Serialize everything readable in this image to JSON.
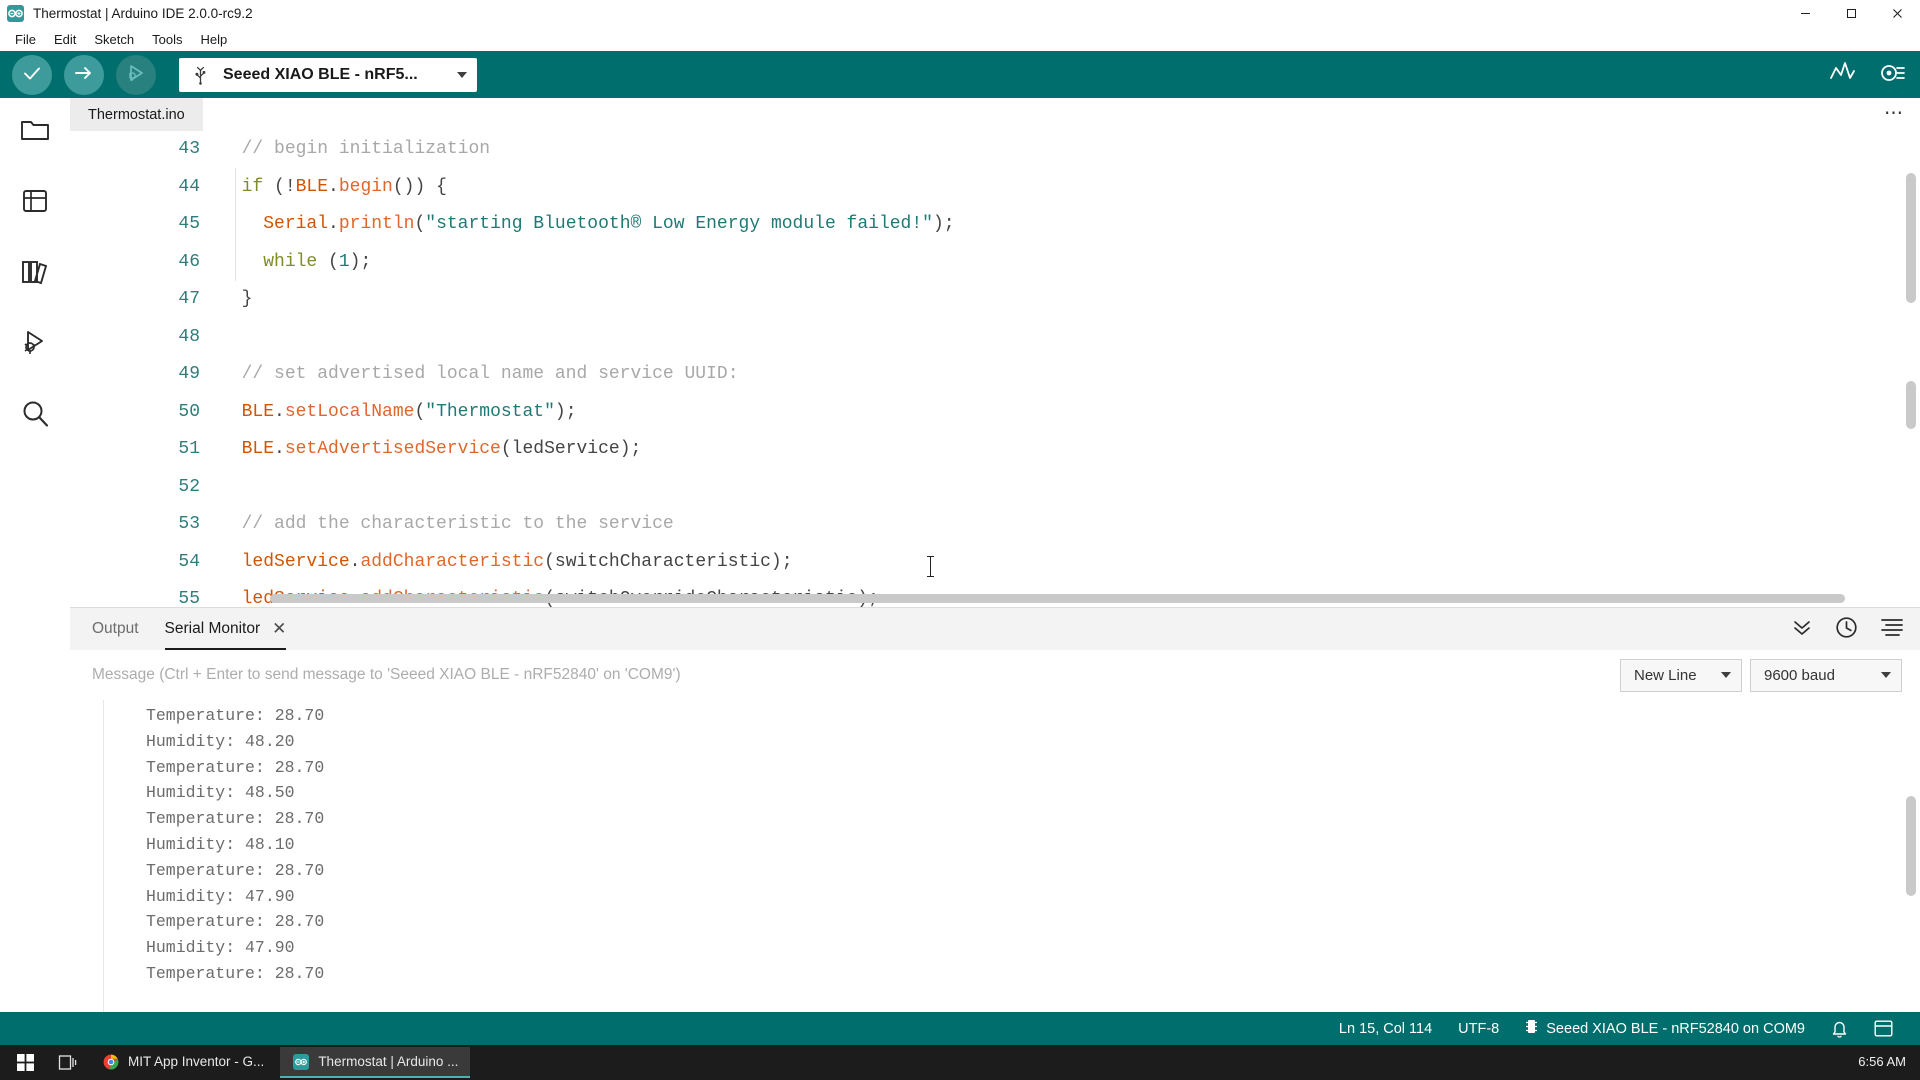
{
  "window": {
    "title": "Thermostat | Arduino IDE 2.0.0-rc9.2",
    "app_icon": "arduino-infinity-icon",
    "minimize_label": "─",
    "maximize_label": "☐",
    "close_label": "✕"
  },
  "menubar": {
    "items": [
      {
        "label": "File"
      },
      {
        "label": "Edit"
      },
      {
        "label": "Sketch"
      },
      {
        "label": "Tools"
      },
      {
        "label": "Help"
      }
    ]
  },
  "toolbar": {
    "verify_icon": "checkmark-icon",
    "upload_icon": "arrow-right-icon",
    "debug_icon": "debug-bug-icon",
    "board_selector": {
      "usb_icon": "usb-icon",
      "value": "Seeed XIAO BLE - nRF5...",
      "caret_icon": "chevron-down-icon"
    },
    "serial_plotter_icon": "serial-plotter-icon",
    "serial_monitor_icon": "serial-monitor-icon",
    "accent_color": "#006e6d"
  },
  "activity_bar": {
    "items": [
      {
        "name": "sketchbook",
        "icon": "folder-icon"
      },
      {
        "name": "boards-manager",
        "icon": "boards-manager-icon"
      },
      {
        "name": "library-manager",
        "icon": "library-books-icon"
      },
      {
        "name": "debug",
        "icon": "debug-icon"
      },
      {
        "name": "search",
        "icon": "search-icon"
      }
    ]
  },
  "editor": {
    "tabs": [
      {
        "label": "Thermostat.ino",
        "active": true
      }
    ],
    "more_label": "⋯",
    "lines": [
      {
        "num": "43",
        "tokens": [
          {
            "t": "  ",
            "c": "g-pln"
          },
          {
            "t": "// begin initialization",
            "c": "g-com"
          }
        ]
      },
      {
        "num": "44",
        "tokens": [
          {
            "t": "  ",
            "c": "g-pln"
          },
          {
            "t": "if",
            "c": "g-key"
          },
          {
            "t": " (!",
            "c": "g-pln"
          },
          {
            "t": "BLE",
            "c": "g-obj"
          },
          {
            "t": ".",
            "c": "g-pln"
          },
          {
            "t": "begin",
            "c": "g-fn"
          },
          {
            "t": "()) {",
            "c": "g-pln"
          }
        ]
      },
      {
        "num": "45",
        "tokens": [
          {
            "t": "    ",
            "c": "g-pln"
          },
          {
            "t": "Serial",
            "c": "g-obj"
          },
          {
            "t": ".",
            "c": "g-pln"
          },
          {
            "t": "println",
            "c": "g-fn"
          },
          {
            "t": "(",
            "c": "g-pln"
          },
          {
            "t": "\"starting Bluetooth® Low Energy module failed!\"",
            "c": "g-str"
          },
          {
            "t": ");",
            "c": "g-pln"
          }
        ]
      },
      {
        "num": "46",
        "tokens": [
          {
            "t": "    ",
            "c": "g-pln"
          },
          {
            "t": "while",
            "c": "g-key"
          },
          {
            "t": " (",
            "c": "g-pln"
          },
          {
            "t": "1",
            "c": "g-num"
          },
          {
            "t": ");",
            "c": "g-pln"
          }
        ]
      },
      {
        "num": "47",
        "tokens": [
          {
            "t": "  }",
            "c": "g-pln"
          }
        ]
      },
      {
        "num": "48",
        "tokens": [
          {
            "t": "",
            "c": "g-pln"
          }
        ]
      },
      {
        "num": "49",
        "tokens": [
          {
            "t": "  ",
            "c": "g-pln"
          },
          {
            "t": "// set advertised local name and service UUID:",
            "c": "g-com"
          }
        ]
      },
      {
        "num": "50",
        "tokens": [
          {
            "t": "  ",
            "c": "g-pln"
          },
          {
            "t": "BLE",
            "c": "g-obj"
          },
          {
            "t": ".",
            "c": "g-pln"
          },
          {
            "t": "setLocalName",
            "c": "g-fn"
          },
          {
            "t": "(",
            "c": "g-pln"
          },
          {
            "t": "\"Thermostat\"",
            "c": "g-str"
          },
          {
            "t": ");",
            "c": "g-pln"
          }
        ]
      },
      {
        "num": "51",
        "tokens": [
          {
            "t": "  ",
            "c": "g-pln"
          },
          {
            "t": "BLE",
            "c": "g-obj"
          },
          {
            "t": ".",
            "c": "g-pln"
          },
          {
            "t": "setAdvertisedService",
            "c": "g-fn"
          },
          {
            "t": "(ledService);",
            "c": "g-pln"
          }
        ]
      },
      {
        "num": "52",
        "tokens": [
          {
            "t": "",
            "c": "g-pln"
          }
        ]
      },
      {
        "num": "53",
        "tokens": [
          {
            "t": "  ",
            "c": "g-pln"
          },
          {
            "t": "// add the characteristic to the service",
            "c": "g-com"
          }
        ]
      },
      {
        "num": "54",
        "tokens": [
          {
            "t": "  ",
            "c": "g-pln"
          },
          {
            "t": "ledService",
            "c": "g-obj"
          },
          {
            "t": ".",
            "c": "g-pln"
          },
          {
            "t": "addCharacteristic",
            "c": "g-fn"
          },
          {
            "t": "(switchCharacteristic);",
            "c": "g-pln"
          }
        ]
      },
      {
        "num": "55",
        "tokens": [
          {
            "t": "  ",
            "c": "g-pln"
          },
          {
            "t": "ledService",
            "c": "g-obj"
          },
          {
            "t": ".",
            "c": "g-pln"
          },
          {
            "t": "addCharacteristic",
            "c": "g-fn"
          },
          {
            "t": "(switchOverrideCharacteristic);",
            "c": "g-pln"
          }
        ]
      }
    ]
  },
  "panel": {
    "tabs": [
      {
        "label": "Output",
        "active": false
      },
      {
        "label": "Serial Monitor",
        "active": true,
        "close_icon": "close-icon",
        "close_label": "✕"
      }
    ],
    "actions": [
      {
        "name": "collapse-panel",
        "icon": "chevron-double-down-icon"
      },
      {
        "name": "toggle-timestamp",
        "icon": "clock-icon"
      },
      {
        "name": "clear-output",
        "icon": "clear-output-icon"
      }
    ],
    "serial_monitor": {
      "input_placeholder": "Message (Ctrl + Enter to send message to 'Seeed XIAO BLE - nRF52840' on 'COM9')",
      "line_ending": "New Line",
      "baud_rate": "9600 baud",
      "caret_icon": "chevron-down-icon",
      "output_lines": [
        "Temperature: 28.70",
        "Humidity: 48.20",
        "Temperature: 28.70",
        "Humidity: 48.50",
        "Temperature: 28.70",
        "Humidity: 48.10",
        "Temperature: 28.70",
        "Humidity: 47.90",
        "Temperature: 28.70",
        "Humidity: 47.90",
        "Temperature: 28.70"
      ]
    }
  },
  "statusbar": {
    "cursor_position": "Ln 15, Col 114",
    "encoding": "UTF-8",
    "board_icon": "chip-icon",
    "board_port": "Seeed XIAO BLE - nRF52840 on COM9",
    "notifications_icon": "bell-icon",
    "layout_icon": "panel-layout-icon"
  },
  "taskbar": {
    "start_icon": "windows-start-icon",
    "taskview_icon": "task-view-icon",
    "buttons": [
      {
        "label": "MIT App Inventor - G...",
        "icon": "chrome-icon",
        "active": false
      },
      {
        "label": "Thermostat | Arduino ...",
        "icon": "arduino-infinity-icon",
        "active": true
      }
    ],
    "clock": "6:56 AM"
  }
}
